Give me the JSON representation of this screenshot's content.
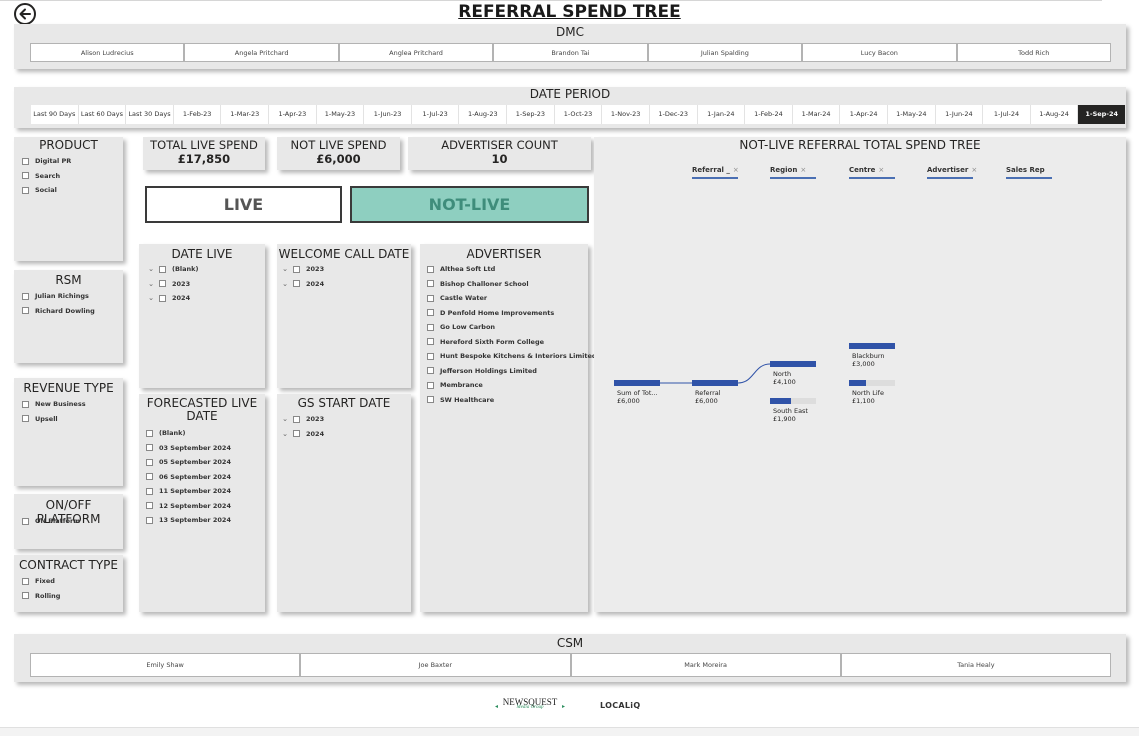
{
  "page": {
    "title": "REFERRAL SPEND TREE"
  },
  "dmc": {
    "title": "DMC",
    "items": [
      "Alison Ludrecius",
      "Angela Pritchard",
      "Anglea Pritchard",
      "Brandon Tai",
      "Julian Spalding",
      "Lucy Bacon",
      "Todd Rich"
    ]
  },
  "date_period": {
    "title": "DATE PERIOD",
    "items": [
      "Last 90 Days",
      "Last 60 Days",
      "Last 30 Days",
      "1-Feb-23",
      "1-Mar-23",
      "1-Apr-23",
      "1-May-23",
      "1-Jun-23",
      "1-Jul-23",
      "1-Aug-23",
      "1-Sep-23",
      "1-Oct-23",
      "1-Nov-23",
      "1-Dec-23",
      "1-Jan-24",
      "1-Feb-24",
      "1-Mar-24",
      "1-Apr-24",
      "1-May-24",
      "1-Jun-24",
      "1-Jul-24",
      "1-Aug-24",
      "1-Sep-24"
    ],
    "selected": "1-Sep-24"
  },
  "product": {
    "title": "PRODUCT",
    "options": [
      "Digital PR",
      "Search",
      "Social"
    ]
  },
  "rsm": {
    "title": "RSM",
    "options": [
      "Julian Richings",
      "Richard Dowling"
    ]
  },
  "revenue_type": {
    "title": "REVENUE TYPE",
    "options": [
      "New Business",
      "Upsell"
    ]
  },
  "platform": {
    "title": "ON/OFF PLATFORM",
    "options": [
      "ON Platform"
    ]
  },
  "contract_type": {
    "title": "CONTRACT TYPE",
    "options": [
      "Fixed",
      "Rolling"
    ]
  },
  "kpis": {
    "total_live": {
      "label": "TOTAL LIVE SPEND",
      "value": "£17,850"
    },
    "not_live": {
      "label": "NOT LIVE SPEND",
      "value": "£6,000"
    },
    "advertiser_count": {
      "label": "ADVERTISER COUNT",
      "value": "10"
    }
  },
  "toggle": {
    "live": "LIVE",
    "not_live": "NOT-LIVE"
  },
  "date_live": {
    "title": "DATE LIVE",
    "options": [
      "(Blank)",
      "2023",
      "2024"
    ]
  },
  "welcome_call": {
    "title": "WELCOME CALL DATE",
    "options": [
      "2023",
      "2024"
    ]
  },
  "advertiser": {
    "title": "ADVERTISER",
    "options": [
      "Althea Soft Ltd",
      "Bishop Challoner School",
      "Castle Water",
      "D Penfold Home Improvements",
      "Go Low Carbon",
      "Hereford Sixth Form College",
      "Hunt Bespoke Kitchens & Interiors Limited",
      "Jefferson Holdings Limited",
      "Membrance",
      "SW Healthcare"
    ]
  },
  "forecasted_live": {
    "title_line1": "FORECASTED LIVE",
    "title_line2": "DATE",
    "options": [
      "(Blank)",
      "03 September 2024",
      "05 September 2024",
      "06 September 2024",
      "11 September 2024",
      "12 September 2024",
      "13 September 2024"
    ]
  },
  "gs_start": {
    "title": "GS START DATE",
    "options": [
      "2023",
      "2024"
    ]
  },
  "tree": {
    "title": "NOT-LIVE REFERRAL TOTAL SPEND TREE",
    "headers": [
      "Referral _",
      "Region",
      "Centre",
      "Advertiser",
      "Sales Rep"
    ],
    "root": {
      "label": "Sum of  Tot...",
      "value": "£6,000",
      "fill": 1.0
    },
    "level1": [
      {
        "label": "Referral",
        "value": "£6,000",
        "fill": 1.0
      }
    ],
    "level2": [
      {
        "label": "North",
        "value": "£4,100",
        "fill": 1.0
      },
      {
        "label": "South East",
        "value": "£1,900",
        "fill": 0.46
      }
    ],
    "level3": [
      {
        "label": "Blackburn",
        "value": "£3,000",
        "fill": 1.0
      },
      {
        "label": "North Life",
        "value": "£1,100",
        "fill": 0.37
      }
    ]
  },
  "csm": {
    "title": "CSM",
    "items": [
      "Emily Shaw",
      "Joe Baxter",
      "Mark Moreira",
      "Tania Healy"
    ]
  },
  "footer": {
    "newsquest": "NEWSQUEST",
    "newsquest_sub": "Media Group",
    "localiq": "LOCALiQ"
  }
}
